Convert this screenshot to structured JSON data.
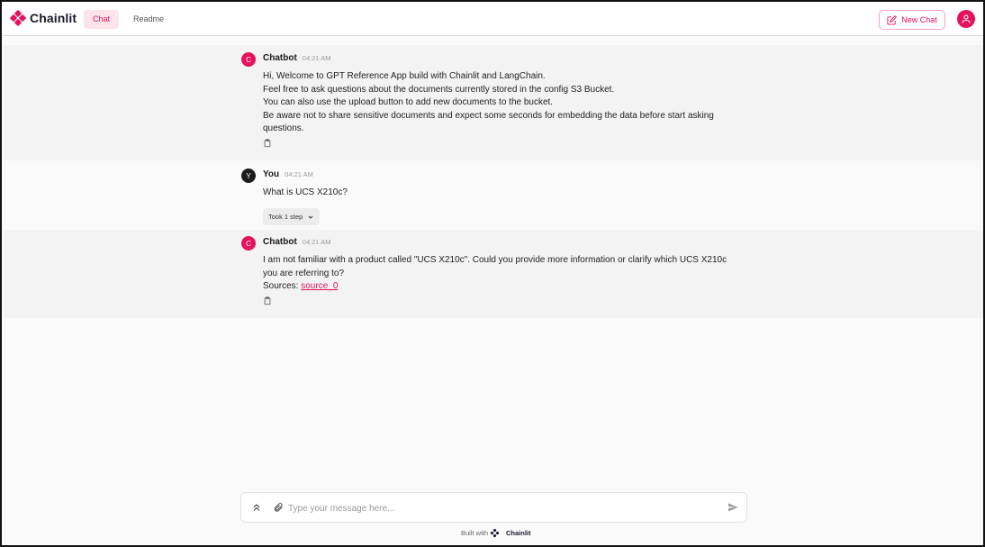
{
  "header": {
    "brand": "Chainlit",
    "tabs": [
      {
        "label": "Chat",
        "active": true
      },
      {
        "label": "Readme",
        "active": false
      }
    ],
    "new_chat_label": "New Chat",
    "accent_color": "#e5135b"
  },
  "messages": [
    {
      "author": "Chatbot",
      "avatar_letter": "C",
      "time": "04:21 AM",
      "lines": [
        "Hi, Welcome to GPT Reference App build with Chainlit and LangChain.",
        "Feel free to ask questions about the documents currently stored in the config S3 Bucket.",
        "You can also use the upload button to add new documents to the bucket.",
        "Be aware not to share sensitive documents and expect some seconds for embedding the data before start asking",
        "questions."
      ]
    },
    {
      "author": "You",
      "avatar_letter": "Y",
      "time": "04:21 AM",
      "lines": [
        "What is UCS X210c?"
      ],
      "step_label": "Took 1 step"
    },
    {
      "author": "Chatbot",
      "avatar_letter": "C",
      "time": "04:21 AM",
      "lines": [
        "I am not familiar with a product called \"UCS X210c\". Could you provide more information or clarify which UCS X210c",
        "you are referring to?"
      ],
      "sources_label": "Sources:",
      "source_link": "source_0"
    }
  ],
  "composer": {
    "placeholder": "Type your message here..."
  },
  "footer": {
    "built_with": "Built with",
    "brand": "Chainlit"
  },
  "icons": [
    "chainlit-logo-icon",
    "new-chat-icon",
    "user-icon",
    "copy-icon",
    "chevron-down-icon",
    "expand-icon",
    "attach-icon",
    "send-icon"
  ]
}
